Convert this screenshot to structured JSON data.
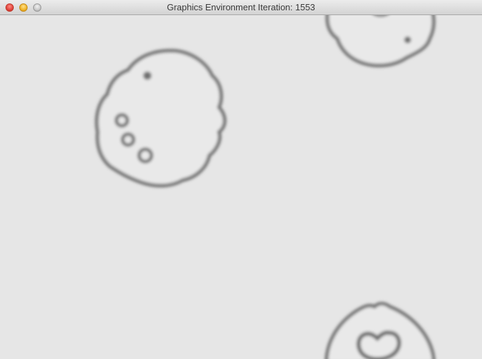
{
  "window": {
    "title": "Graphics Environment Iteration: 1553"
  },
  "controls": {
    "close_icon": "close-icon",
    "minimize_icon": "minimize-icon",
    "zoom_icon": "zoom-icon"
  },
  "canvas": {
    "background": "#e6e6e6",
    "blob_color": "#6f6f6f"
  }
}
